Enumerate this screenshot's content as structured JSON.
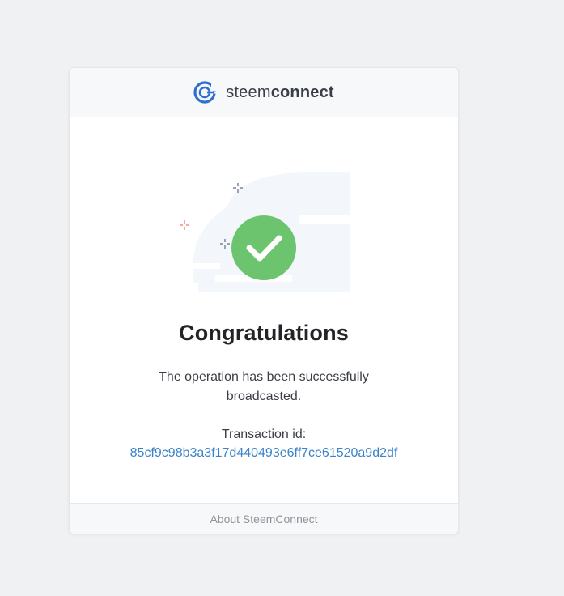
{
  "header": {
    "brand_light": "steem",
    "brand_bold": "connect",
    "logo_icon": "steemconnect-logo-icon",
    "logo_color": "#2f6fd1"
  },
  "illustration": {
    "icon": "success-checkmark-icon",
    "check_color": "#6cc46f",
    "sparkle_colors": [
      "#6d7d96",
      "#f0876b",
      "#6d7d96"
    ]
  },
  "main": {
    "title": "Congratulations",
    "message": "The operation has been successfully broadcasted.",
    "transaction_label": "Transaction id:",
    "transaction_id": "85cf9c98b3a3f17d440493e6ff7ce61520a9d2df",
    "link_color": "#3a83c9"
  },
  "footer": {
    "link_label": "About SteemConnect"
  }
}
